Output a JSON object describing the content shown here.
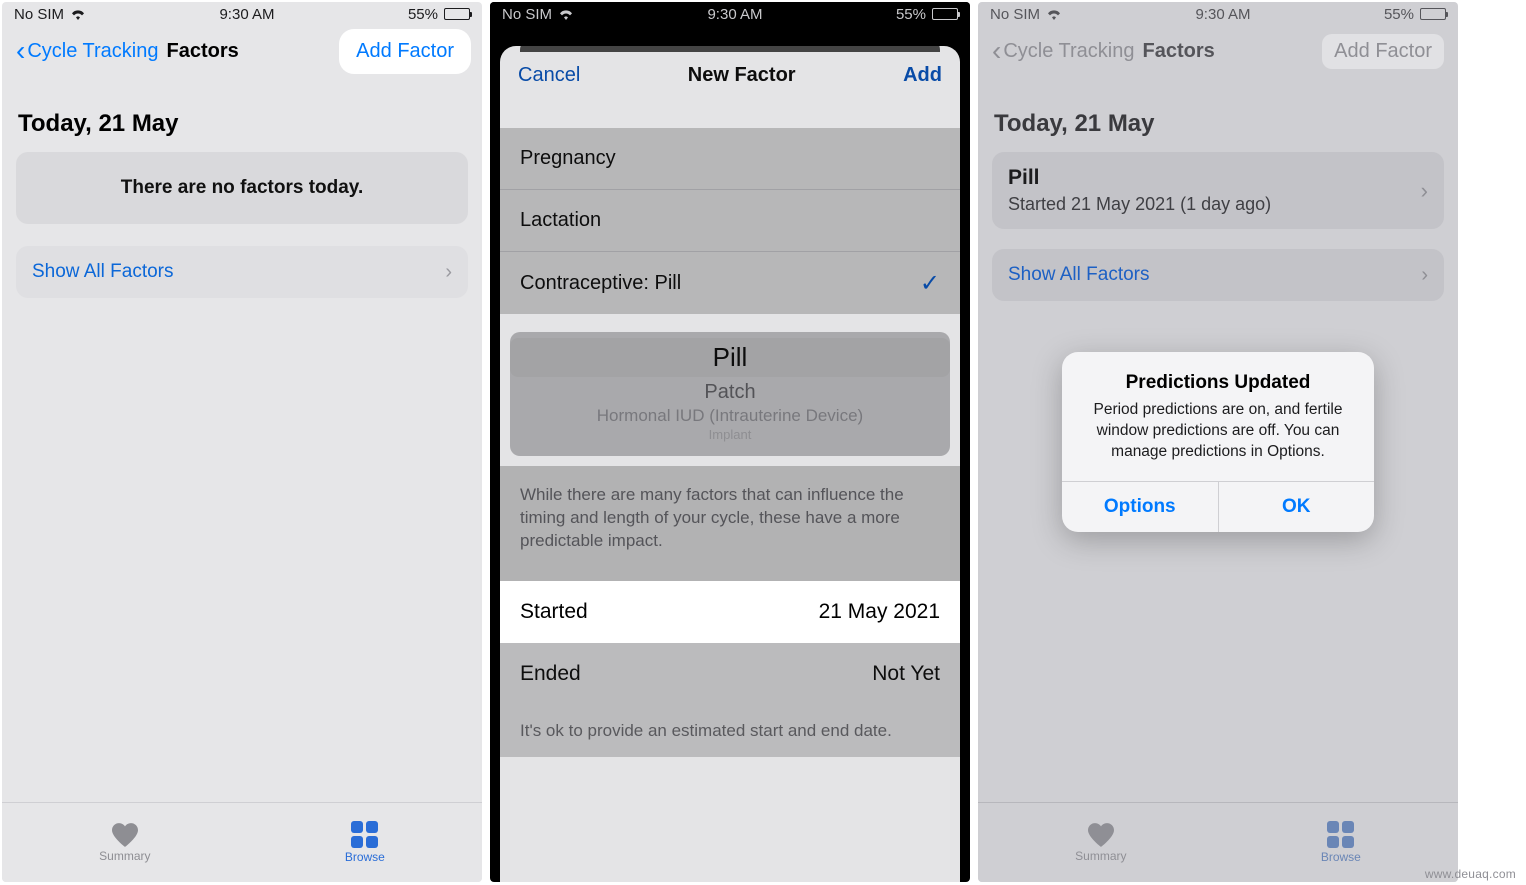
{
  "status": {
    "carrier": "No SIM",
    "time": "9:30 AM",
    "batteryPercent": "55%"
  },
  "screen1": {
    "back": "Cycle Tracking",
    "title": "Factors",
    "addFactor": "Add Factor",
    "dateHeading": "Today, 21 May",
    "emptyMsg": "There are no factors today.",
    "showAll": "Show All Factors",
    "tabs": {
      "summary": "Summary",
      "browse": "Browse"
    }
  },
  "screen2": {
    "cancel": "Cancel",
    "title": "New Factor",
    "add": "Add",
    "options": {
      "pregnancy": "Pregnancy",
      "lactation": "Lactation",
      "contraceptivePill": "Contraceptive: Pill"
    },
    "picker": {
      "selected": "Pill",
      "below1": "Patch",
      "below2": "Hormonal IUD (Intrauterine Device)",
      "below3": "Implant"
    },
    "helper": "While there are many factors that can influence the timing and length of your cycle, these have a more predictable impact.",
    "startedLabel": "Started",
    "startedValue": "21 May 2021",
    "endedLabel": "Ended",
    "endedValue": "Not Yet",
    "footnote": "It's ok to provide an estimated start and end date."
  },
  "screen3": {
    "back": "Cycle Tracking",
    "title": "Factors",
    "addFactor": "Add Factor",
    "dateHeading": "Today, 21 May",
    "factor": {
      "name": "Pill",
      "subtitle": "Started 21 May 2021 (1 day ago)"
    },
    "showAll": "Show All Factors",
    "alert": {
      "title": "Predictions Updated",
      "message": "Period predictions are on, and fertile window predictions are off. You can manage predictions in Options.",
      "options": "Options",
      "ok": "OK"
    },
    "tabs": {
      "summary": "Summary",
      "browse": "Browse"
    }
  },
  "watermark": "www.deuaq.com"
}
